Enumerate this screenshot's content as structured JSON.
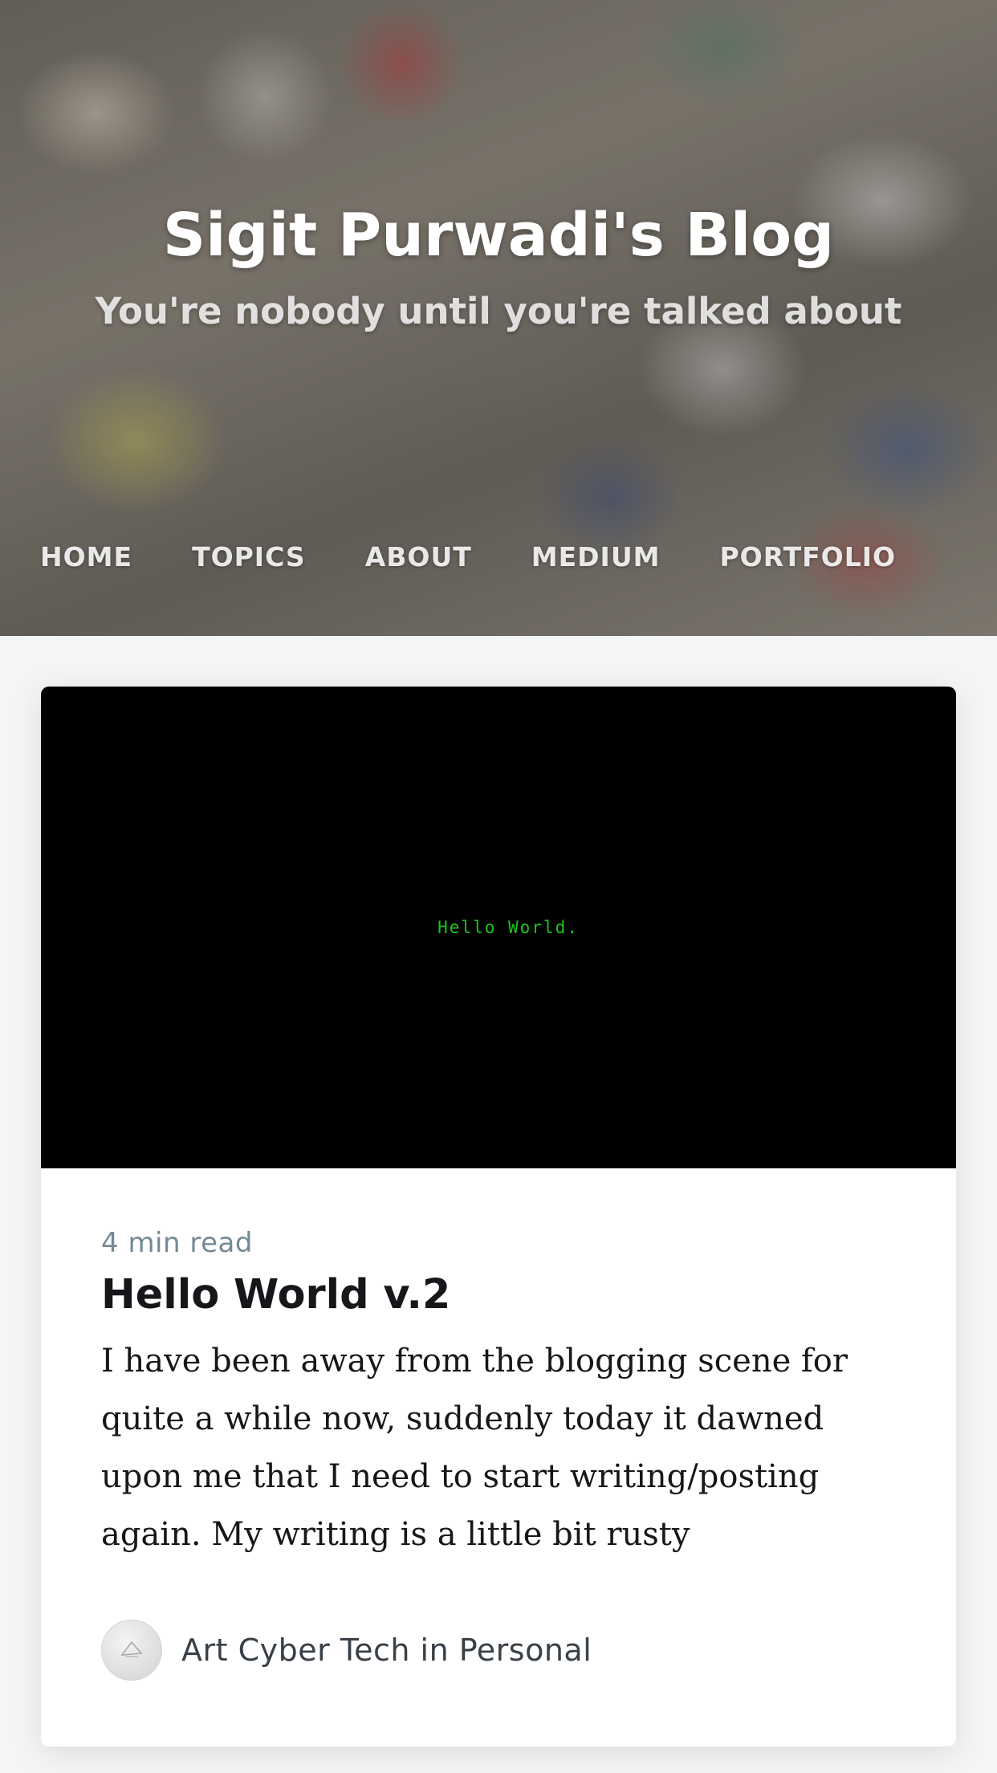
{
  "header": {
    "title": "Sigit Purwadi's Blog",
    "subtitle": "You're nobody until you're talked about"
  },
  "nav": {
    "items": [
      {
        "label": "HOME"
      },
      {
        "label": "TOPICS"
      },
      {
        "label": "ABOUT"
      },
      {
        "label": "MEDIUM"
      },
      {
        "label": "PORTFOLIO"
      }
    ]
  },
  "post": {
    "image_text": "Hello World.",
    "reading_time": "4 min read",
    "title": "Hello World v.2",
    "excerpt": "I have been away from the blogging scene for quite a while now, suddenly today it dawned upon me that I need to start writing/posting again. My writing is a little bit rusty",
    "meta": "Art Cyber Tech in Personal",
    "avatar_icon": "author-avatar-icon"
  },
  "colors": {
    "page_background": "#f4f5f5",
    "card_background": "#ffffff",
    "terminal_green": "#18c61a",
    "meta_gray": "#738a94",
    "title_dark": "#15171a"
  }
}
